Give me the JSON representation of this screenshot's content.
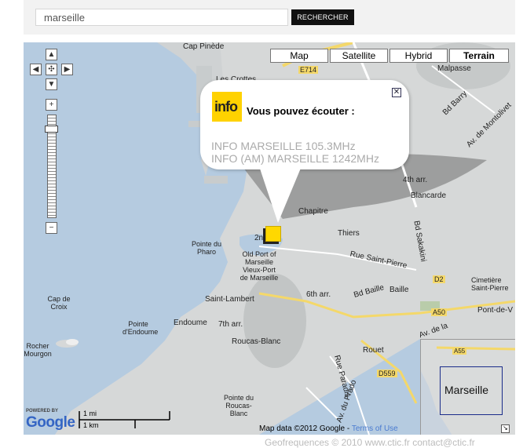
{
  "search": {
    "value": "marseille",
    "button_label": "RECHERCHER"
  },
  "map": {
    "map_types": [
      "Map",
      "Satellite",
      "Hybrid",
      "Terrain"
    ],
    "active_map_type": "Terrain",
    "zoom_in": "+",
    "zoom_out": "−",
    "labels": {
      "cap_pinede": "Cap Pinède",
      "e714": "E714",
      "les_crottes": "Les Crottes",
      "malpasse": "Malpasse",
      "bd_barry": "Bd Barry",
      "av_montolivet": "Av. de Montolivet",
      "fourth_arr": "4th arr.",
      "blancarde": "Blancarde",
      "chapitre": "Chapitre",
      "thiers": "Thiers",
      "bd_sakakini": "Bd Sakakini",
      "second": "2nd",
      "pointe_pharo": "Pointe du Pharo",
      "old_port": "Old Port of Marseille",
      "vieux_port": "Vieux-Port de Marseille",
      "rue_st_pierre": "Rue Saint-Pierre",
      "d2": "D2",
      "cimetiere": "Cimetière Saint-Pierre",
      "cap_croix": "Cap de Croix",
      "saint_lambert": "Saint-Lambert",
      "sixth_arr": "6th arr.",
      "bd_baille": "Bd Baille",
      "baille": "Baille",
      "a50": "A50",
      "pointe_endoume": "Pointe d'Endoume",
      "endoume": "Endoume",
      "seventh_arr": "7th arr.",
      "pont_de_vivaux": "Pont-de-V",
      "rocher_mourgon": "Rocher Mourgon",
      "rouet": "Rouet",
      "roucas_blanc": "Roucas-Blanc",
      "d559": "D559",
      "rue_paradis": "Rue Paradis",
      "av_prado": "Av. du Prado",
      "pointe_roucas": "Pointe du Roucas-Blanc",
      "a55": "A55",
      "av_de_la": "Av. de la"
    },
    "scale": {
      "mi": "1 mi",
      "km": "1 km"
    },
    "powered_by": "POWERED BY",
    "google": "Google",
    "copyright": "Map data ©2012 Google -",
    "terms": "Terms of Use",
    "overview_label": "Marseille",
    "overview_toggle": "↘"
  },
  "infowindow": {
    "logo_text": "info",
    "title": "Vous pouvez écouter :",
    "lines": [
      "INFO MARSEILLE 105.3MHz",
      "INFO (AM) MARSEILLE 1242MHz"
    ],
    "close": "✕"
  },
  "footer": "Geofrequences © 2010 www.ctic.fr contact@ctic.fr",
  "colors": {
    "sea": "#b5cbe0",
    "land": "#d9dbdb",
    "marker": "#ffd800",
    "road_yellow": "#f4d86a"
  }
}
